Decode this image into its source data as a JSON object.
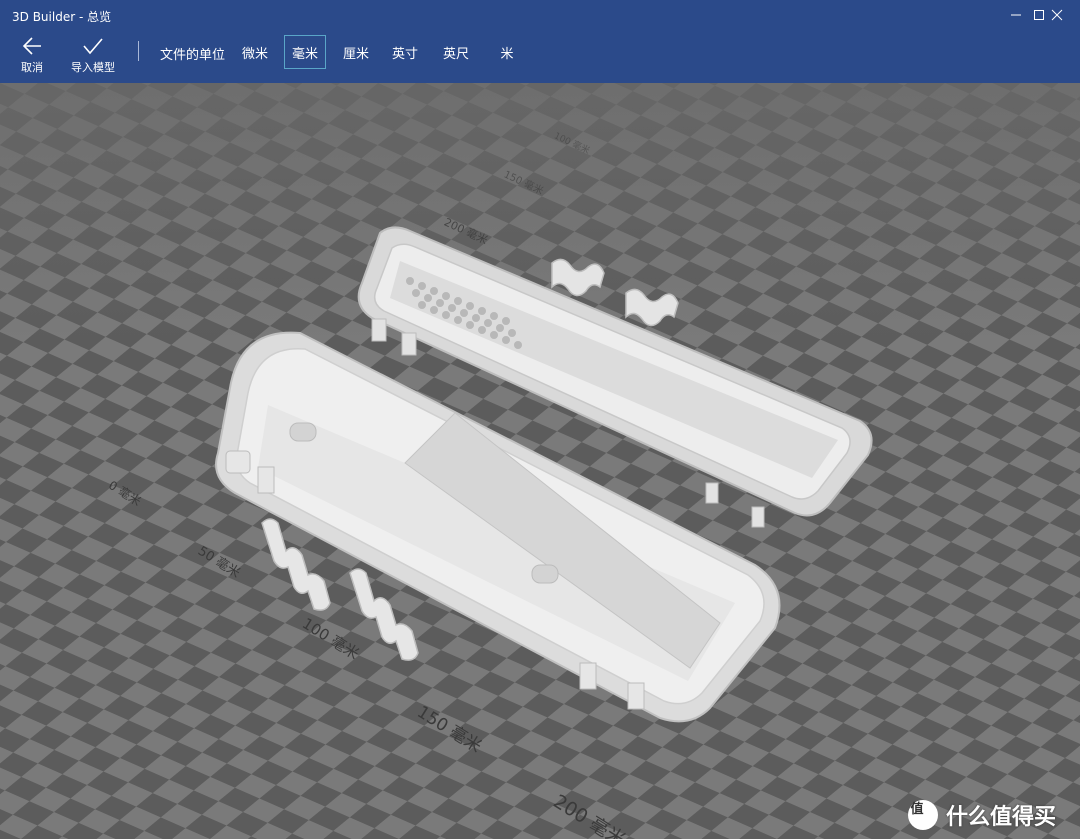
{
  "window": {
    "title": "3D Builder - 总览",
    "controls": [
      "minimize-icon",
      "maximize-icon",
      "close-icon"
    ]
  },
  "toolbar": {
    "cancel_label": "取消",
    "import_label": "导入模型",
    "unit_title": "文件的单位",
    "units": [
      {
        "label": "微米",
        "selected": false
      },
      {
        "label": "毫米",
        "selected": true
      },
      {
        "label": "厘米",
        "selected": false
      },
      {
        "label": "英寸",
        "selected": false
      },
      {
        "label": "英尺",
        "selected": false
      },
      {
        "label": "米",
        "selected": false
      }
    ]
  },
  "viewport": {
    "axis_labels_near": [
      "0 毫米",
      "50 毫米",
      "100 毫米",
      "150 毫米",
      "200 毫米"
    ],
    "axis_labels_far": [
      "200 毫米",
      "150 毫米",
      "100 毫米"
    ]
  },
  "watermark": {
    "text": "什么值得买",
    "icon": "zhi-badge-icon"
  },
  "colors": {
    "titlebar": "#2b4a8a",
    "grid_dark": "#5c5c5c",
    "grid_light": "#7a7a7a",
    "model": "#e6e6e6"
  }
}
